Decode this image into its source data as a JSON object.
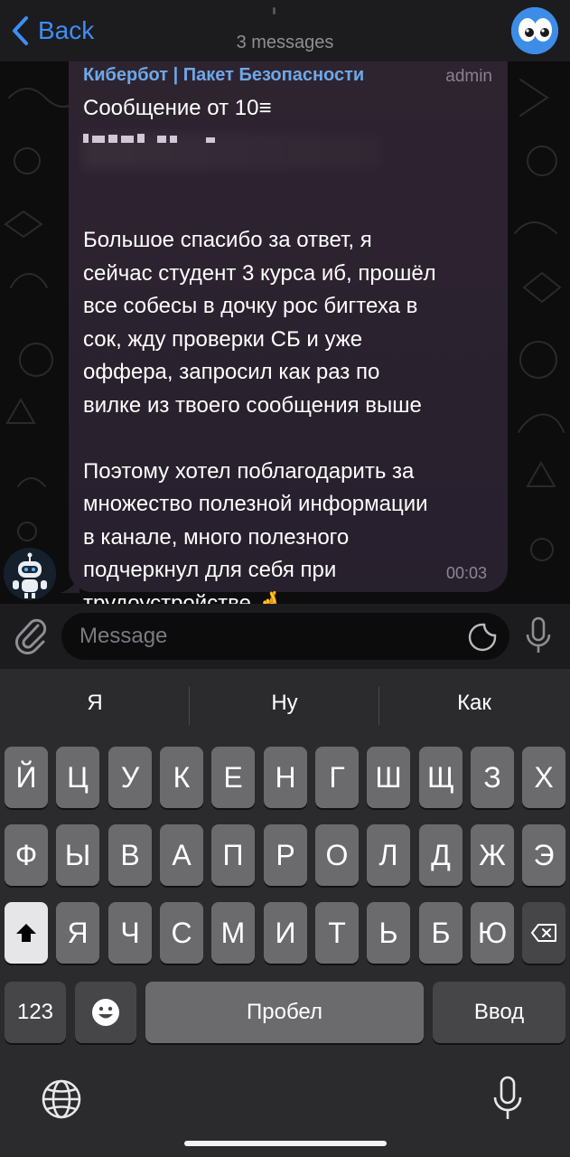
{
  "header": {
    "back_label": "Back",
    "subtitle": "3 messages"
  },
  "message": {
    "sender": "Кибербот | Пакет Безопасности",
    "badge": "admin",
    "text": "Сообщение от 10≡\n\n\n\nБольшое спасибо за ответ, я\nсейчас студент 3 курса иб, прошёл\nвсе собесы в дочку рос бигтеха в\nсок, жду проверки СБ и уже\nоффера, запросил как раз по\nвилке из твоего сообщения выше\n\nПоэтому хотел поблагодарить за\nмножество полезной информации\nв канале, много полезного\nподчеркнул для себя при\nтрудоустройстве 🤞",
    "time": "00:03"
  },
  "input": {
    "placeholder": "Message"
  },
  "keyboard": {
    "suggestions": [
      "Я",
      "Ну",
      "Как"
    ],
    "row1": [
      "Й",
      "Ц",
      "У",
      "К",
      "Е",
      "Н",
      "Г",
      "Ш",
      "Щ",
      "З",
      "Х"
    ],
    "row2": [
      "Ф",
      "Ы",
      "В",
      "А",
      "П",
      "Р",
      "О",
      "Л",
      "Д",
      "Ж",
      "Э"
    ],
    "row3": [
      "Я",
      "Ч",
      "С",
      "М",
      "И",
      "Т",
      "Ь",
      "Б",
      "Ю"
    ],
    "numbers_label": "123",
    "space_label": "Пробел",
    "return_label": "Ввод"
  },
  "icons": {
    "back": "chevron-left-icon",
    "channel_avatar": "eyes-emoji-avatar",
    "bot_avatar": "robot-avatar",
    "attach": "paperclip-icon",
    "sticker": "sticker-icon",
    "mic": "microphone-icon",
    "shift": "shift-icon",
    "backspace": "backspace-icon",
    "emoji": "emoji-icon",
    "globe": "globe-icon"
  },
  "colors": {
    "accent": "#3e8ef7",
    "sender_name": "#6ea8e8",
    "bubble": "#2c2230"
  }
}
